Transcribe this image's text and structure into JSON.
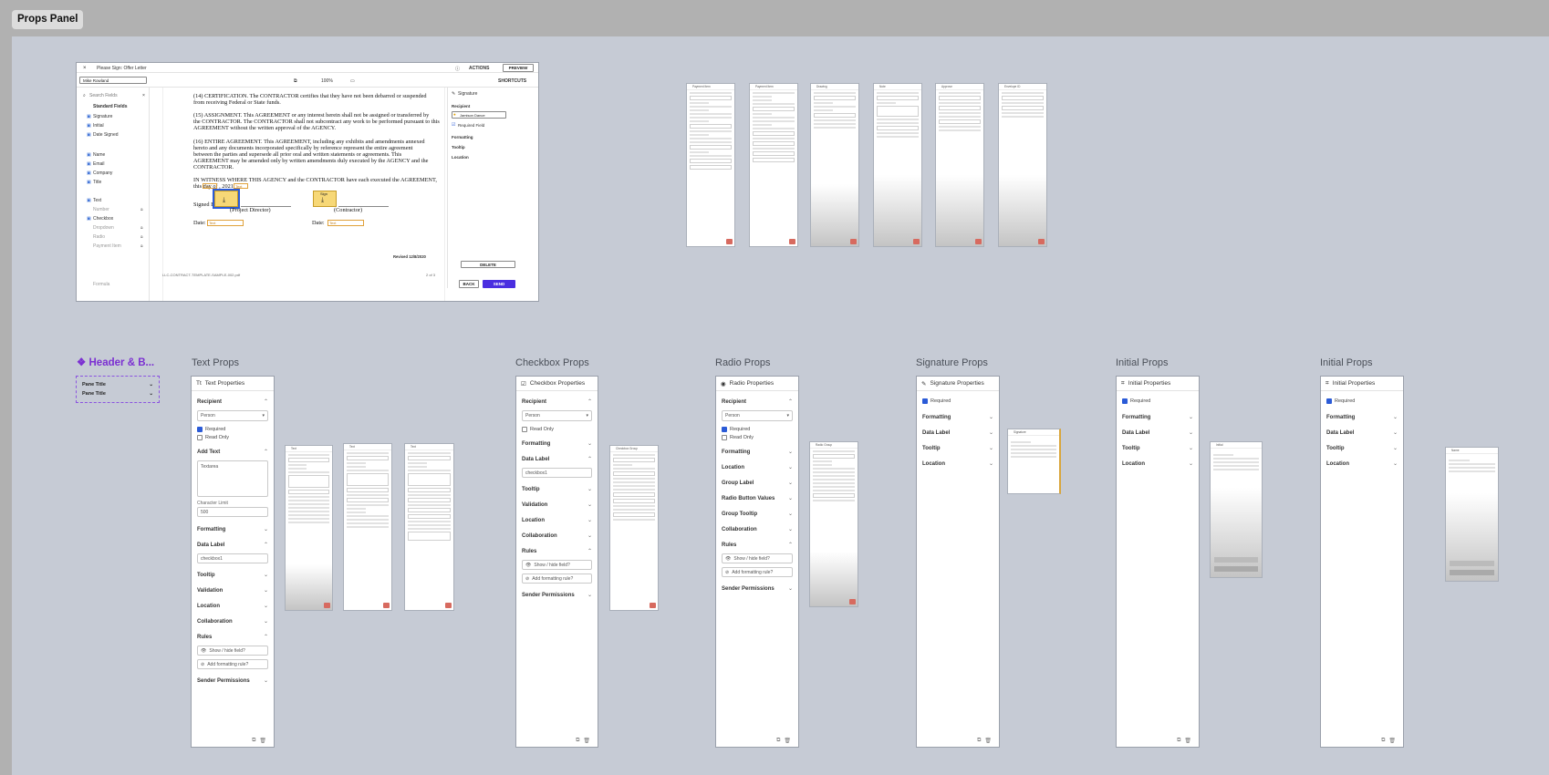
{
  "page": {
    "title": "Props Panel"
  },
  "header_b": {
    "title": "❖ Header & B...",
    "row1": "Pane Title",
    "row2": "Pane Title"
  },
  "section_labels": {
    "text": "Text Props",
    "checkbox": "Checkbox Props",
    "radio": "Radio Props",
    "signature": "Signature Props",
    "initial1": "Initial Props",
    "initial2": "Initial Props"
  },
  "doc": {
    "close": "×",
    "title": "Please Sign: Offer Letter",
    "actions": "ACTIONS",
    "preview": "PREVIEW",
    "shortcuts": "SHORTCUTS",
    "signer": "Mike Rowland",
    "zoom": "100%",
    "search_placeholder": "Search Fields",
    "standard_fields": "Standard Fields",
    "fields": [
      "Signature",
      "Initial",
      "Date Signed",
      "Name",
      "Email",
      "Company",
      "Title",
      "Text",
      "Number",
      "Checkbox",
      "Dropdown",
      "Radio",
      "Payment Item",
      "Formula"
    ],
    "body": [
      "(14)  CERTIFICATION.  The CONTRACTOR certifies that they have not been debarred or suspended",
      "from receiving Federal or State funds.",
      "(15)  ASSIGNMENT.  This AGREEMENT or any interest herein shall not be assigned or transferred by",
      "the CONTRACTOR. The CONTRACTOR shall not subcontract any work to be performed pursuant to this",
      "AGREEMENT without the written approval of the AGENCY.",
      "(16)  ENTIRE AGREEMENT.  This AGREEMENT, including any exhibits and amendments annexed",
      "hereto and any documents incorporated specifically by reference represent the entire agreement",
      "between the parties and supersede all prior oral and written statements or agreements. This",
      "AGREEMENT may be amended only by written amendments duly executed by the AGENCY and the",
      "CONTRACTOR.",
      "IN WITNESS WHERE THIS AGENCY and the CONTRACTOR have each executed the AGREEMENT,",
      "this          day of          , 2021."
    ],
    "signed_by": "Signed By:",
    "project_director": "(Project Director)",
    "contractor": "(Contractor)",
    "date1": "Date:",
    "date2": "Date:",
    "text_ph": "Text",
    "sign": "Sign",
    "revised": "Revised 12/8/2020",
    "filename": "LLC-CONTRACT-TEMPLATE-SAMPLE-002.pdf",
    "pager": "2 of 3",
    "panel_title": "Signature",
    "recipient": "Recipient",
    "recipient_value": "Jamison Dance",
    "required_field": "Required Field",
    "formatting": "Formatting",
    "tooltip": "Tooltip",
    "location": "Location",
    "delete": "DELETE",
    "back": "BACK",
    "send": "SEND"
  },
  "text_panel": {
    "title": "Text Properties",
    "recipient": "Recipient",
    "person": "Person",
    "required": "Required",
    "read_only": "Read Only",
    "add_text": "Add Text",
    "textarea": "Textarea",
    "char_limit_label": "Character Limit",
    "char_limit": "500",
    "formatting": "Formatting",
    "data_label": "Data Label",
    "data_label_value": "checkbox1",
    "tooltip": "Tooltip",
    "validation": "Validation",
    "location": "Location",
    "collaboration": "Collaboration",
    "rules": "Rules",
    "show_hide": "Show / hide field?",
    "add_format": "Add formatting rule?",
    "sender_permissions": "Sender Permissions"
  },
  "checkbox_panel": {
    "title": "Checkbox Properties",
    "recipient": "Recipient",
    "person": "Person",
    "read_only": "Read Only",
    "formatting": "Formatting",
    "data_label": "Data Label",
    "data_label_value": "checkbox1",
    "tooltip": "Tooltip",
    "validation": "Validation",
    "location": "Location",
    "collaboration": "Collaboration",
    "rules": "Rules",
    "show_hide": "Show / hide field?",
    "add_format": "Add formatting rule?",
    "sender_permissions": "Sender Permissions"
  },
  "radio_panel": {
    "title": "Radio Properties",
    "recipient": "Recipient",
    "person": "Person",
    "required": "Required",
    "read_only": "Read Only",
    "formatting": "Formatting",
    "location": "Location",
    "group_label": "Group Label",
    "radio_button_values": "Radio Button Values",
    "group_tooltip": "Group Tooltip",
    "collaboration": "Collaboration",
    "rules": "Rules",
    "show_hide": "Show / hide field?",
    "add_format": "Add formatting rule?",
    "sender_permissions": "Sender Permissions"
  },
  "signature_panel": {
    "title": "Signature Properties",
    "required": "Required",
    "formatting": "Formatting",
    "data_label": "Data Label",
    "tooltip": "Tooltip",
    "location": "Location"
  },
  "initial_panel_1": {
    "title": "Initial Properties",
    "required": "Required",
    "formatting": "Formatting",
    "data_label": "Data Label",
    "tooltip": "Tooltip",
    "location": "Location"
  },
  "initial_panel_2": {
    "title": "Initial Properties",
    "required": "Required",
    "formatting": "Formatting",
    "data_label": "Data Label",
    "tooltip": "Tooltip",
    "location": "Location"
  },
  "colors": {
    "accent": "#2b5bd7",
    "send": "#4a2ee0",
    "header_purple": "#7b2fd2",
    "field_yellow": "#f7d877",
    "canvas": "#c6cbd5"
  }
}
